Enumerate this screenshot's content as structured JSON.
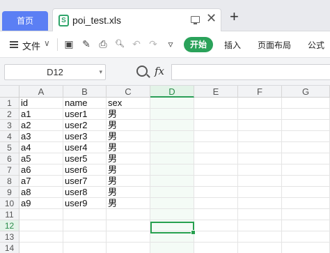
{
  "tabs": {
    "home_label": "首页",
    "file_label": "poi_test.xls",
    "file_icon_glyph": "S",
    "close_glyph": "✕",
    "add_glyph": "+"
  },
  "toolbar": {
    "file_menu_label": "文件",
    "chevron": "∨",
    "start_label": "开始",
    "insert_label": "插入",
    "layout_label": "页面布局",
    "formula_label": "公式",
    "icons": [
      "save-icon",
      "format-painter-icon",
      "print-icon",
      "print-preview-icon",
      "undo-icon",
      "redo-icon",
      "more-icon"
    ],
    "icon_glyphs": {
      "save": "▣",
      "painter": "✎",
      "print": "⎙",
      "preview": "🔍︎",
      "undo": "↶",
      "redo": "↷",
      "more": "▿"
    }
  },
  "formula_bar": {
    "cell_ref": "D12",
    "fx_label": "fx",
    "formula_value": "",
    "namebox_chevron": "▾"
  },
  "sheet": {
    "columns": [
      "A",
      "B",
      "C",
      "D",
      "E",
      "F",
      "G"
    ],
    "row_numbers": [
      "1",
      "2",
      "3",
      "4",
      "5",
      "6",
      "7",
      "8",
      "9",
      "10",
      "11",
      "12",
      "13",
      "14"
    ],
    "rows": [
      [
        "id",
        "name",
        "sex"
      ],
      [
        "a1",
        "user1",
        "男"
      ],
      [
        "a2",
        "user2",
        "男"
      ],
      [
        "a3",
        "user3",
        "男"
      ],
      [
        "a4",
        "user4",
        "男"
      ],
      [
        "a5",
        "user5",
        "男"
      ],
      [
        "a6",
        "user6",
        "男"
      ],
      [
        "a7",
        "user7",
        "男"
      ],
      [
        "a8",
        "user8",
        "男"
      ],
      [
        "a9",
        "user9",
        "男"
      ],
      [
        "",
        "",
        ""
      ],
      [
        "",
        "",
        ""
      ],
      [
        "",
        "",
        ""
      ],
      [
        "",
        "",
        ""
      ]
    ],
    "active_column": "D",
    "active_row": "12"
  }
}
